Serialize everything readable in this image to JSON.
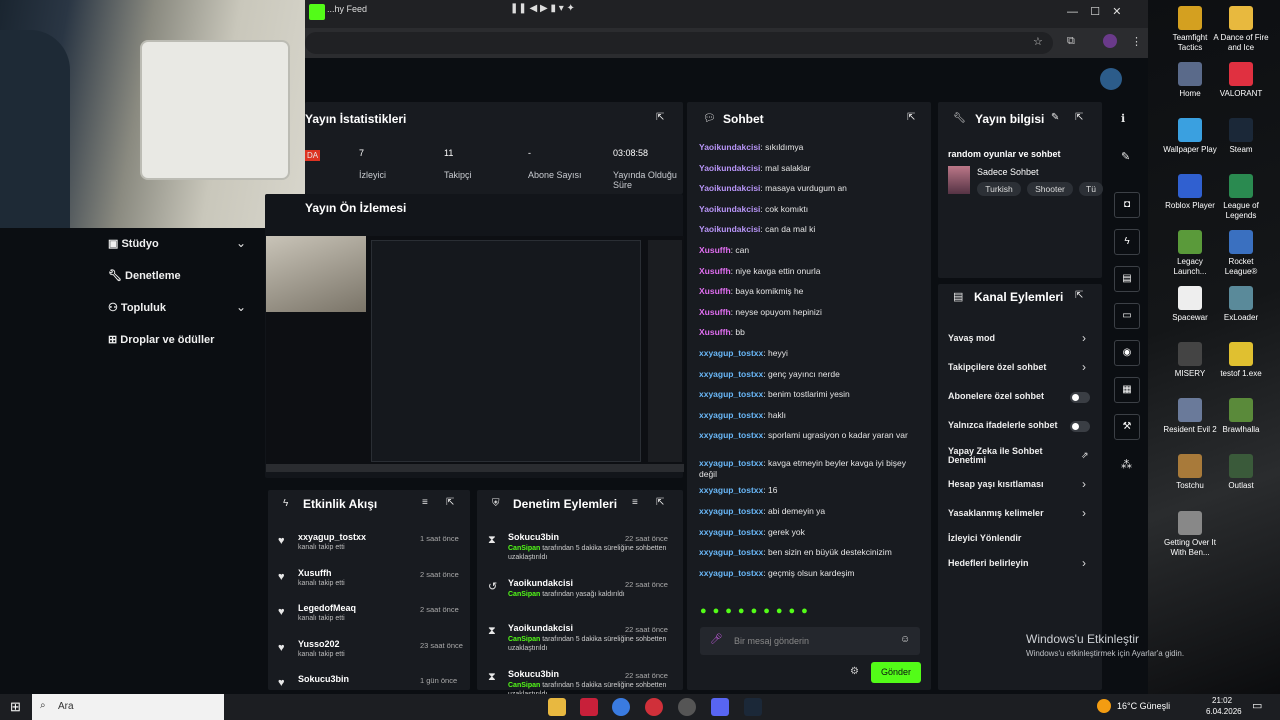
{
  "browser": {
    "tab_title": "...hy Feed"
  },
  "left_nav": [
    {
      "label": "Stüdyo",
      "chevron": true
    },
    {
      "label": "Denetleme",
      "chevron": false
    },
    {
      "label": "Topluluk",
      "chevron": true
    },
    {
      "label": "Droplar ve ödüller",
      "chevron": false
    }
  ],
  "stats": {
    "title": "Yayın İstatistikleri",
    "badge": "DA",
    "items": [
      {
        "value": "7",
        "label": "İzleyici"
      },
      {
        "value": "11",
        "label": "Takipçi"
      },
      {
        "value": "-",
        "label": "Abone Sayısı"
      },
      {
        "value": "03:08:58",
        "label": "Yayında Olduğu Süre"
      }
    ]
  },
  "preview": {
    "title": "Yayın Ön İzlemesi"
  },
  "activity": {
    "title": "Etkinlik Akışı",
    "items": [
      {
        "name": "xxyagup_tostxx",
        "sub": "kanalı takip etti",
        "time": "1 saat önce"
      },
      {
        "name": "Xusuffh",
        "sub": "kanalı takip etti",
        "time": "2 saat önce"
      },
      {
        "name": "LegedofMeaq",
        "sub": "kanalı takip etti",
        "time": "2 saat önce"
      },
      {
        "name": "Yusso202",
        "sub": "kanalı takip etti",
        "time": "23 saat önce"
      },
      {
        "name": "Sokucu3bin",
        "sub": "",
        "time": "1 gün önce"
      }
    ]
  },
  "moderation": {
    "title": "Denetim Eylemleri",
    "items": [
      {
        "name": "Sokucu3bin",
        "actor": "CanSipan",
        "text": " tarafından 5 dakika süreliğine sohbetten uzaklaştırıldı",
        "time": "22 saat önce",
        "icon": "hourglass-icon"
      },
      {
        "name": "Yaoikundakcisi",
        "actor": "CanSipan",
        "text": " tarafından yasağı kaldırıldı",
        "time": "22 saat önce",
        "icon": "undo-icon"
      },
      {
        "name": "Yaoikundakcisi",
        "actor": "CanSipan",
        "text": " tarafından 5 dakika süreliğine sohbetten uzaklaştırıldı",
        "time": "22 saat önce",
        "icon": "hourglass-icon"
      },
      {
        "name": "Sokucu3bin",
        "actor": "CanSipan",
        "text": " tarafından 5 dakika süreliğine sohbetten uzaklaştırıldı",
        "time": "22 saat önce",
        "icon": "hourglass-icon"
      }
    ]
  },
  "chat": {
    "title": "Sohbet",
    "messages": [
      {
        "user": "Yaoikundakcisi",
        "text": "sıkıldımya",
        "c": "u1"
      },
      {
        "user": "Yaoikundakcisi",
        "text": "mal salaklar",
        "c": "u1"
      },
      {
        "user": "Yaoikundakcisi",
        "text": "masaya vurdugum an",
        "c": "u1"
      },
      {
        "user": "Yaoikundakcisi",
        "text": "cok komıktı",
        "c": "u1"
      },
      {
        "user": "Yaoikundakcisi",
        "text": "can da mal ki",
        "c": "u1"
      },
      {
        "user": "Xusuffh",
        "text": "can",
        "c": "u2"
      },
      {
        "user": "Xusuffh",
        "text": "niye kavga ettin onurla",
        "c": "u2"
      },
      {
        "user": "Xusuffh",
        "text": "baya komikmiş he",
        "c": "u2"
      },
      {
        "user": "Xusuffh",
        "text": "neyse opuyom hepinizi",
        "c": "u2"
      },
      {
        "user": "Xusuffh",
        "text": "bb",
        "c": "u2"
      },
      {
        "user": "xxyagup_tostxx",
        "text": "heyyi",
        "c": "u3"
      },
      {
        "user": "xxyagup_tostxx",
        "text": "genç yayıncı nerde",
        "c": "u3"
      },
      {
        "user": "xxyagup_tostxx",
        "text": "benim tostlarimi yesin",
        "c": "u3"
      },
      {
        "user": "xxyagup_tostxx",
        "text": "haklı",
        "c": "u3"
      },
      {
        "user": "xxyagup_tostxx",
        "text": "sporlami ugrasiyon o kadar yaran var",
        "c": "u3",
        "two": true
      },
      {
        "user": "xxyagup_tostxx",
        "text": "kavga etmeyin beyler kavga iyi bişey değil",
        "c": "u3",
        "two": true
      },
      {
        "user": "xxyagup_tostxx",
        "text": "16",
        "c": "u3"
      },
      {
        "user": "xxyagup_tostxx",
        "text": "abi demeyin ya",
        "c": "u3"
      },
      {
        "user": "xxyagup_tostxx",
        "text": "gerek yok",
        "c": "u3"
      },
      {
        "user": "xxyagup_tostxx",
        "text": "ben sizin en büyük destekcinizim",
        "c": "u3"
      },
      {
        "user": "xxyagup_tostxx",
        "text": "geçmiş olsun kardeşim",
        "c": "u3"
      }
    ],
    "input_placeholder": "Bir mesaj gönderin",
    "send": "Gönder"
  },
  "stream_info": {
    "title": "Yayın bilgisi",
    "stream_title": "random oyunlar ve sohbet",
    "category": "Sadece Sohbet",
    "tags": [
      "Turkish",
      "Shooter",
      "Tü"
    ]
  },
  "channel_actions": {
    "title": "Kanal Eylemleri",
    "items": [
      {
        "label": "Yavaş mod",
        "ctrl": "arrow"
      },
      {
        "label": "Takipçilere özel sohbet",
        "ctrl": "arrow"
      },
      {
        "label": "Abonelere özel sohbet",
        "ctrl": "toggle"
      },
      {
        "label": "Yalnızca ifadelerle sohbet",
        "ctrl": "toggle"
      },
      {
        "label": "Yapay Zeka ile Sohbet Denetimi",
        "ctrl": "ext"
      },
      {
        "label": "Hesap yaşı kısıtlaması",
        "ctrl": "arrow"
      },
      {
        "label": "Yasaklanmış kelimeler",
        "ctrl": "arrow"
      },
      {
        "label": "İzleyici Yönlendir",
        "ctrl": "none"
      },
      {
        "label": "Hedefleri belirleyin",
        "ctrl": "arrow"
      }
    ]
  },
  "desktop_icons": [
    "Teamfight Tactics",
    "A Dance of Fire and Ice",
    "Home",
    "VALORANT",
    "Wallpaper Play",
    "Steam",
    "Roblox Player",
    "League of Legends",
    "Legacy Launch...",
    "Rocket League®",
    "Spacewar",
    "ExLoader",
    "MISERY",
    "testof 1.exe",
    "Resident Evil 2",
    "Brawlhalla",
    "Tostchu",
    "Outlast",
    "Getting Over It With Ben..."
  ],
  "watermark": {
    "line1": "Windows'u Etkinleştir",
    "line2": "Windows'u etkinleştirmek için Ayarlar'a gidin."
  },
  "taskbar": {
    "search": "Ara",
    "weather": "16°C Güneşli",
    "time": "21:02",
    "date": "6.04.2026"
  }
}
